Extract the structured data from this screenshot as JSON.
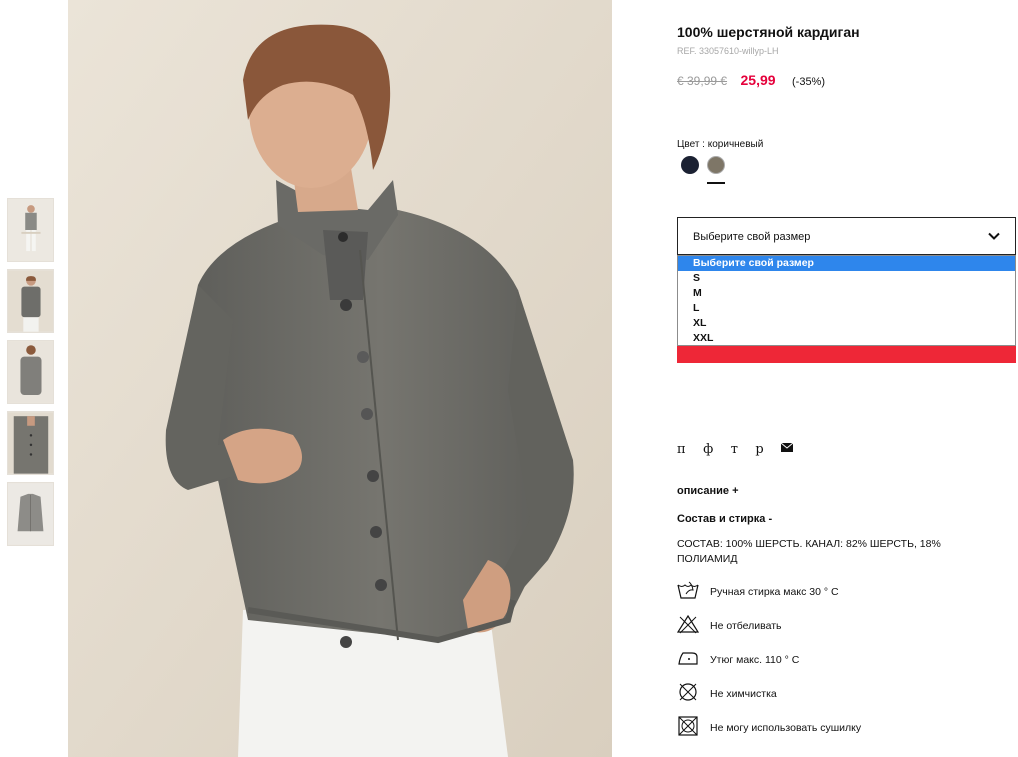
{
  "product": {
    "title": "100% шерстяной кардиган",
    "ref": "REF. 33057610-willyp-LH",
    "old_price": "€ 39,99 €",
    "new_price": "25,99",
    "discount": "(-35%)"
  },
  "color": {
    "label": "Цвет : коричневый",
    "swatches": [
      "#1b2132",
      "#7e7667"
    ],
    "selected": "коричневый"
  },
  "size": {
    "placeholder": "Выберите свой размер",
    "options": [
      "Выберите свой размер",
      "S",
      "M",
      "L",
      "XL",
      "XXL"
    ]
  },
  "share": {
    "letters": [
      "п",
      "ф",
      "т",
      "р"
    ]
  },
  "sections": {
    "description": "описание +",
    "composition_head": "Состав и стирка -",
    "composition_text": "СОСТАВ: 100% ШЕРСТЬ. КАНАЛ: 82% ШЕРСТЬ, 18% ПОЛИАМИД"
  },
  "care": [
    {
      "icon": "hand-wash-icon",
      "text": "Ручная стирка макс 30 ° C"
    },
    {
      "icon": "no-bleach-icon",
      "text": "Не отбеливать"
    },
    {
      "icon": "iron-icon",
      "text": "Утюг макс. 110 ° C"
    },
    {
      "icon": "no-dry-clean-icon",
      "text": "Не химчистка"
    },
    {
      "icon": "no-tumble-dry-icon",
      "text": "Не могу использовать сушилку"
    }
  ],
  "colors": {
    "sale": "#e5003b",
    "cta": "#ee2737",
    "select_highlight": "#2e86ec"
  }
}
